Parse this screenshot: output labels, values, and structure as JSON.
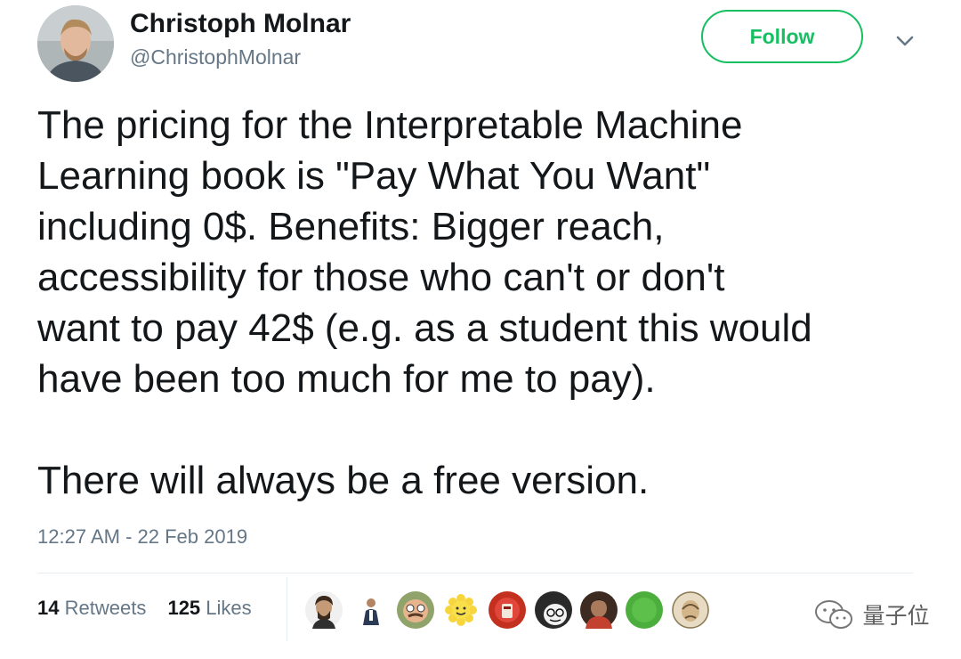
{
  "author": {
    "display_name": "Christoph Molnar",
    "handle": "@ChristophMolnar"
  },
  "actions": {
    "follow_label": "Follow",
    "menu_icon": "chevron-down-icon"
  },
  "tweet": {
    "text": "The pricing for the Interpretable Machine\nLearning book is \"Pay What You Want\"\nincluding 0$. Benefits: Bigger reach,\naccessibility for those who can't or don't\nwant to pay 42$ (e.g. as a student this would\nhave been too much for me to pay).\n\nThere will always be a free version.",
    "timestamp": "12:27 AM - 22 Feb 2019"
  },
  "stats": {
    "retweets_count": "14",
    "retweets_label": "Retweets",
    "likes_count": "125",
    "likes_label": "Likes"
  },
  "likers": [
    "liker-avatar-1",
    "liker-avatar-2",
    "liker-avatar-3",
    "liker-avatar-4",
    "liker-avatar-5",
    "liker-avatar-6",
    "liker-avatar-7",
    "liker-avatar-8",
    "liker-avatar-9"
  ],
  "watermark": {
    "text": "量子位"
  },
  "colors": {
    "follow_green": "#17bf63",
    "secondary_text": "#657786",
    "primary_text": "#14171a",
    "divider": "#e6ecf0"
  }
}
